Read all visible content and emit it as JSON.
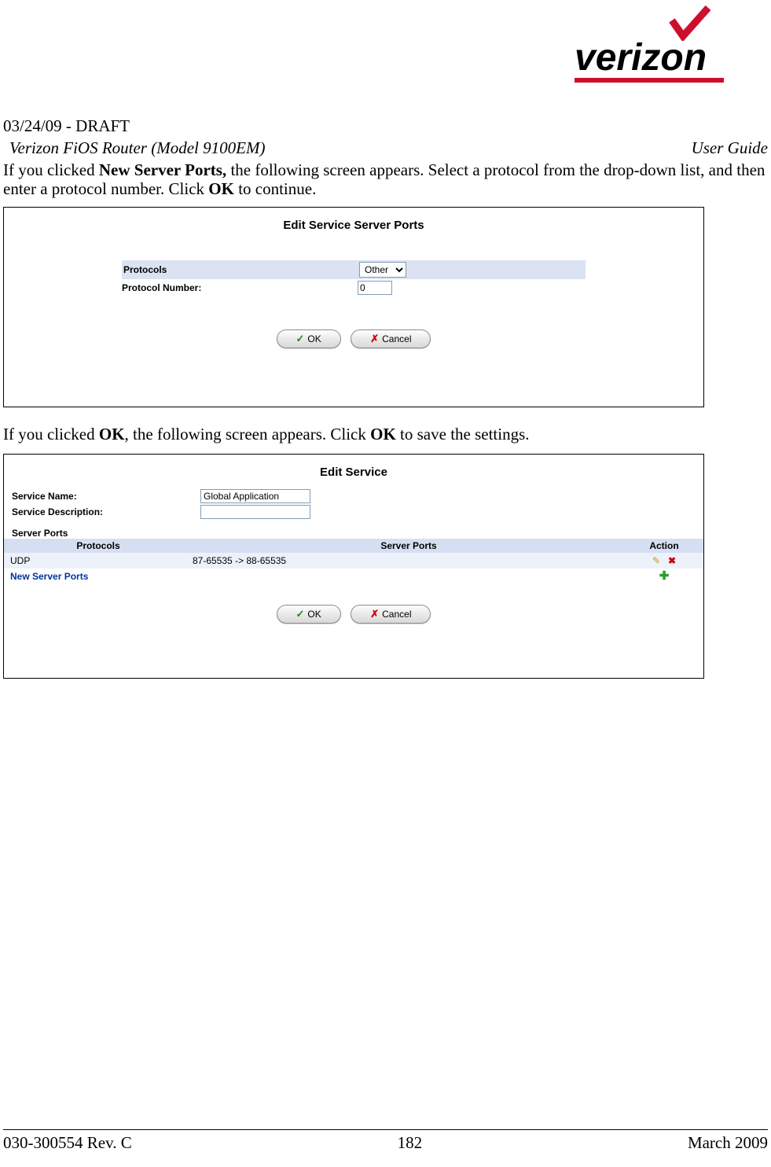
{
  "header": {
    "draft_line": "03/24/09 - DRAFT",
    "model_line": "Verizon FiOS Router (Model 9100EM)",
    "guide_label": "User Guide",
    "logo_word": "verizon"
  },
  "para1": {
    "t1": "If you clicked ",
    "b1": "New Server Ports,",
    "t2": " the following screen appears. Select a protocol from the drop-down list, and then enter a protocol number. Click ",
    "b2": "OK",
    "t3": " to continue."
  },
  "panel1": {
    "title": "Edit Service Server Ports",
    "row1_label": "Protocols",
    "row1_value": "Other",
    "row2_label": "Protocol Number:",
    "row2_value": "0",
    "ok_label": "OK",
    "cancel_label": "Cancel"
  },
  "para2": {
    "t1": "If you clicked ",
    "b1": "OK",
    "t2": ", the following screen appears. Click ",
    "b2": "OK",
    "t3": " to save the settings."
  },
  "panel2": {
    "title": "Edit Service",
    "service_name_label": "Service Name:",
    "service_name_value": "Global Application",
    "service_desc_label": "Service Description:",
    "service_desc_value": "",
    "server_ports_label": "Server Ports",
    "cols": {
      "protocols": "Protocols",
      "server_ports": "Server Ports",
      "action": "Action"
    },
    "rows": [
      {
        "proto": "UDP",
        "ports": "87-65535 -> 88-65535"
      },
      {
        "proto": "New Server Ports",
        "ports": ""
      }
    ],
    "ok_label": "OK",
    "cancel_label": "Cancel"
  },
  "footer": {
    "left": "030-300554 Rev. C",
    "center": "182",
    "right": "March 2009"
  }
}
